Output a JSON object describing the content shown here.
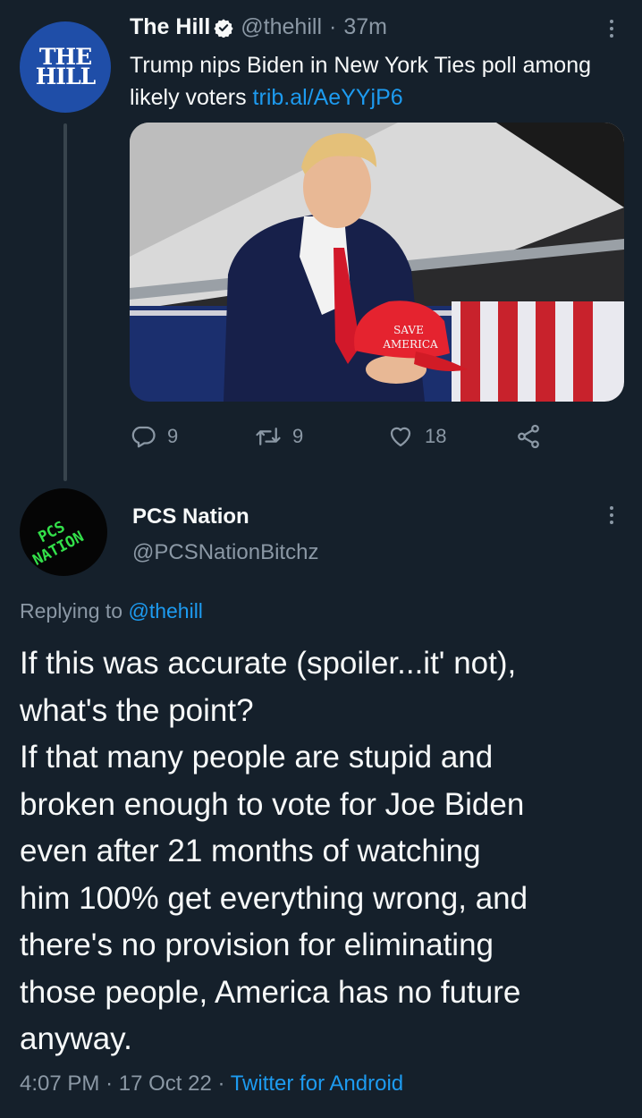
{
  "tweet1": {
    "avatar_text_line1": "THE",
    "avatar_text_line2": "HILL",
    "display_name": "The Hill",
    "handle": "@thehill",
    "separator": "·",
    "time": "37m",
    "text": "Trump nips Biden in New York Ties poll among likely voters",
    "link": "trib.al/AeYYjP6",
    "image_text_line1": "SAVE",
    "image_text_line2": "AMERICA",
    "reply_count": "9",
    "retweet_count": "9",
    "like_count": "18"
  },
  "tweet2": {
    "avatar_text_line1": "PCS",
    "avatar_text_line2": "NATION",
    "display_name": "PCS Nation",
    "handle": "@PCSNationBitchz",
    "replying_prefix": "Replying to",
    "replying_to": "@thehill",
    "text_lines": [
      "If this was accurate (spoiler...it' not),",
      "what's the point?",
      "If that many people are stupid and",
      "broken enough to vote for Joe Biden",
      "even after 21 months of watching",
      "him 100% get everything wrong, and",
      "there's no provision for eliminating",
      "those people, America has no future",
      "anyway."
    ],
    "time": "4:07 PM",
    "date": "17 Oct 22",
    "separator": "·",
    "source": "Twitter for Android"
  },
  "colors": {
    "background": "#15202b",
    "link": "#1d9bf0",
    "muted": "#8b98a5",
    "avatar_hill": "#1f4ea8",
    "avatar_pcs_text": "#33e04a"
  },
  "icons": [
    "verified-badge-icon",
    "more-options-icon",
    "reply-icon",
    "retweet-icon",
    "like-icon",
    "share-icon"
  ]
}
